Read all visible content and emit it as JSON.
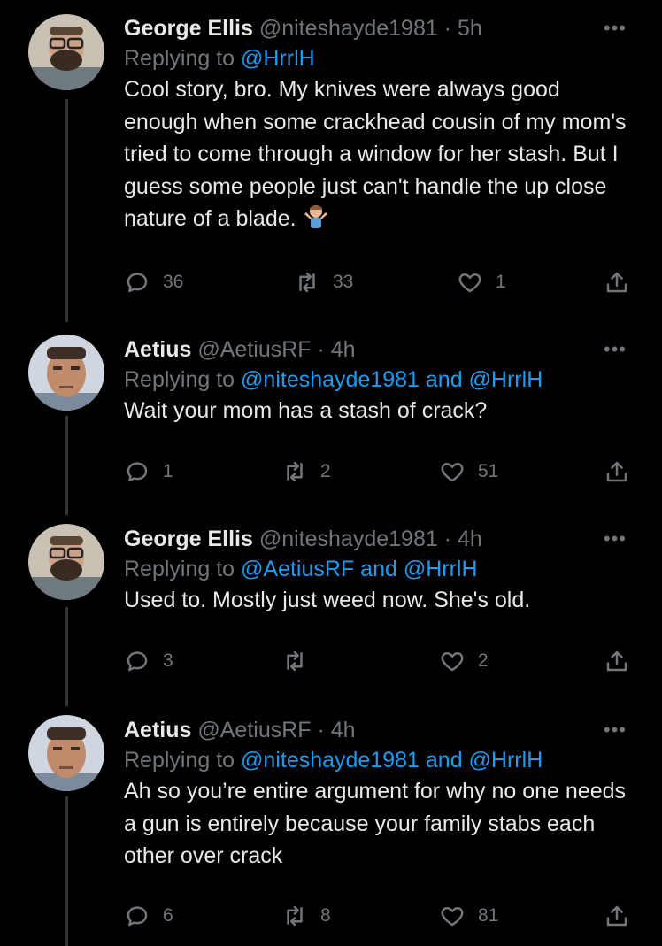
{
  "tweets": [
    {
      "name": "George Ellis",
      "handle": "@niteshayde1981",
      "dot": "·",
      "time": "5h",
      "replying_prefix": "Replying to",
      "replying_mentions": "@HrrlH",
      "text": "Cool story, bro. My knives were always good enough when some crackhead cousin of my mom's tried to come through a window for her stash. But I guess some people just can't handle the up close nature of a blade.",
      "emoji": "person-shrugging-emoji",
      "replies": "36",
      "retweets": "33",
      "likes": "1"
    },
    {
      "name": "Aetius",
      "handle": "@AetiusRF",
      "dot": "·",
      "time": "4h",
      "replying_prefix": "Replying to",
      "replying_mentions": "@niteshayde1981 and @HrrlH",
      "text": "Wait your mom has a stash of crack?",
      "replies": "1",
      "retweets": "2",
      "likes": "51"
    },
    {
      "name": "George Ellis",
      "handle": "@niteshayde1981",
      "dot": "·",
      "time": "4h",
      "replying_prefix": "Replying to",
      "replying_mentions": "@AetiusRF and @HrrlH",
      "text": "Used to. Mostly just weed now. She's old.",
      "replies": "3",
      "retweets": "",
      "likes": "2"
    },
    {
      "name": "Aetius",
      "handle": "@AetiusRF",
      "dot": "·",
      "time": "4h",
      "replying_prefix": "Replying to",
      "replying_mentions": "@niteshayde1981 and @HrrlH",
      "text": "Ah so you’re entire argument for why no one needs a gun is entirely because your family stabs each other over crack",
      "replies": "6",
      "retweets": "8",
      "likes": "81"
    }
  ],
  "colors": {
    "background": "#000000",
    "text": "#e7e9ea",
    "muted": "#71767b",
    "link": "#1d9bf0",
    "thread_line": "#333639"
  },
  "icons": [
    "more-icon",
    "reply-icon",
    "retweet-icon",
    "like-icon",
    "share-icon"
  ]
}
